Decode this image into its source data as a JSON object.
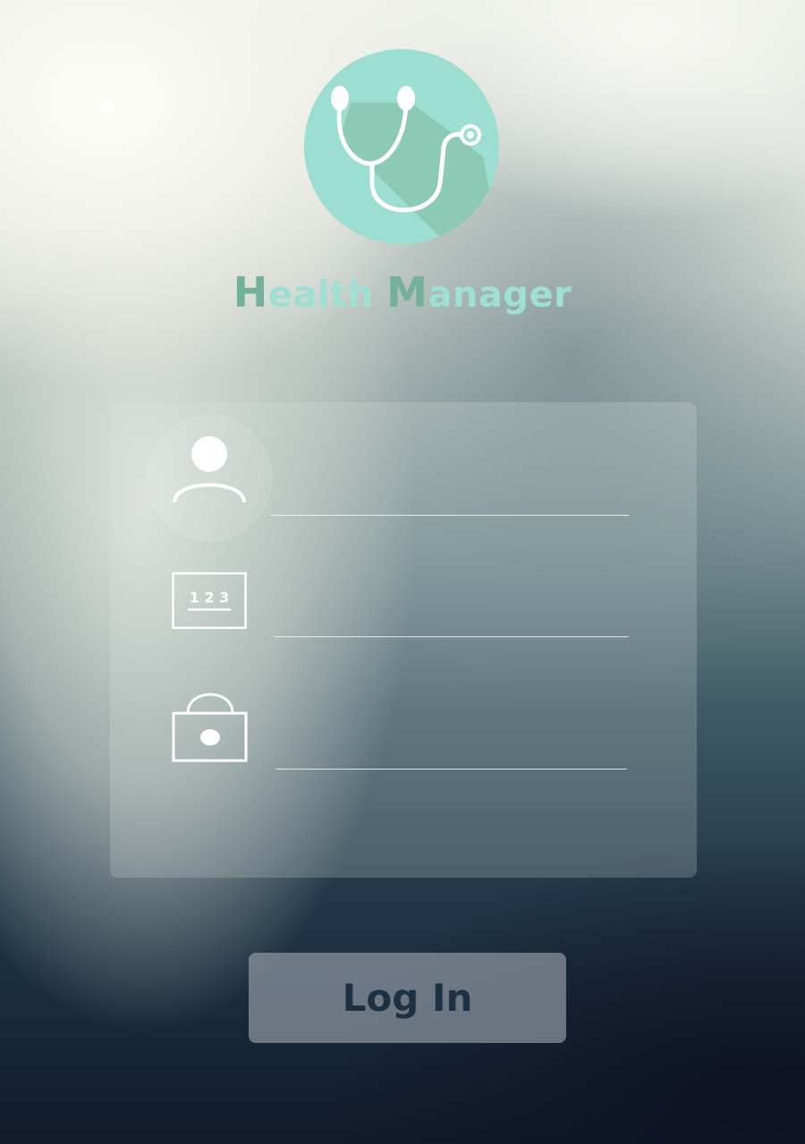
{
  "app": {
    "title_parts": [
      "H",
      "ealth ",
      "M",
      "anager"
    ],
    "logo_icon": "stethoscope-icon",
    "colors": {
      "logo_bg": "#9cded2",
      "logo_shadow": "#8ccab6",
      "title_accent": "#73b19d",
      "title_main": "#9ee0d4"
    }
  },
  "form": {
    "fields": [
      {
        "icon": "user-icon",
        "value": "",
        "placeholder": ""
      },
      {
        "icon": "id-number-icon",
        "badge_text": "1 2 3",
        "value": "",
        "placeholder": ""
      },
      {
        "icon": "lock-icon",
        "value": "",
        "placeholder": ""
      }
    ]
  },
  "login_button": {
    "label": "Log In"
  }
}
